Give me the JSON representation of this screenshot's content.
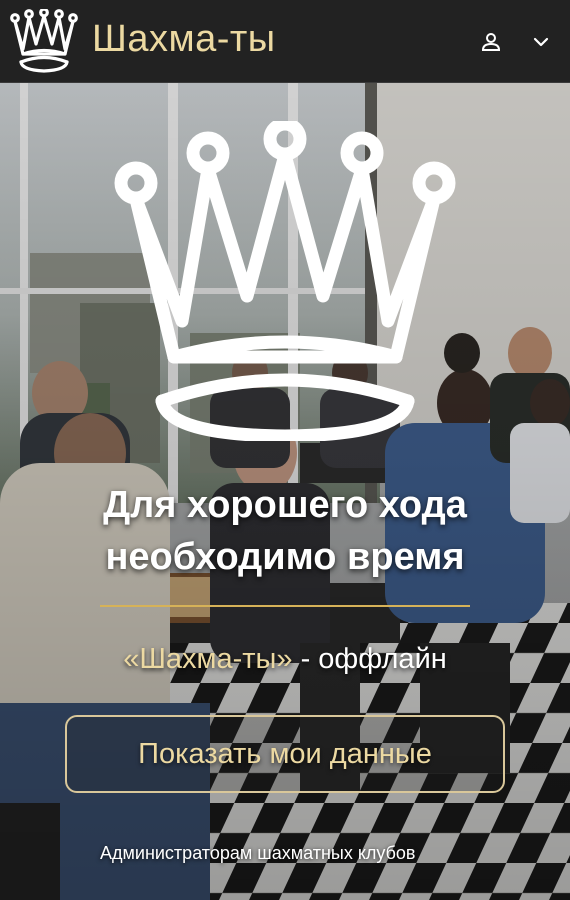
{
  "header": {
    "brand": "Шахма-ты",
    "logo_icon": "crown-icon",
    "user_icon": "user-icon",
    "menu_icon": "chevron-down-icon"
  },
  "hero": {
    "background": "photo of people playing chess at tables in a bright club room",
    "crown_icon": "crown-icon",
    "headline_line1": "Для хорошего хода",
    "headline_line2": "необходимо время",
    "subtitle_brand": "«Шахма-ты»",
    "subtitle_rest": " - оффлайн",
    "show_button_label": "Показать мои данные",
    "admin_link": "Администраторам шахматных клубов"
  },
  "colors": {
    "header_bg": "#222222",
    "brand": "#ecd9a2",
    "divider": "#d6b258",
    "button_border": "#d9c79a"
  }
}
